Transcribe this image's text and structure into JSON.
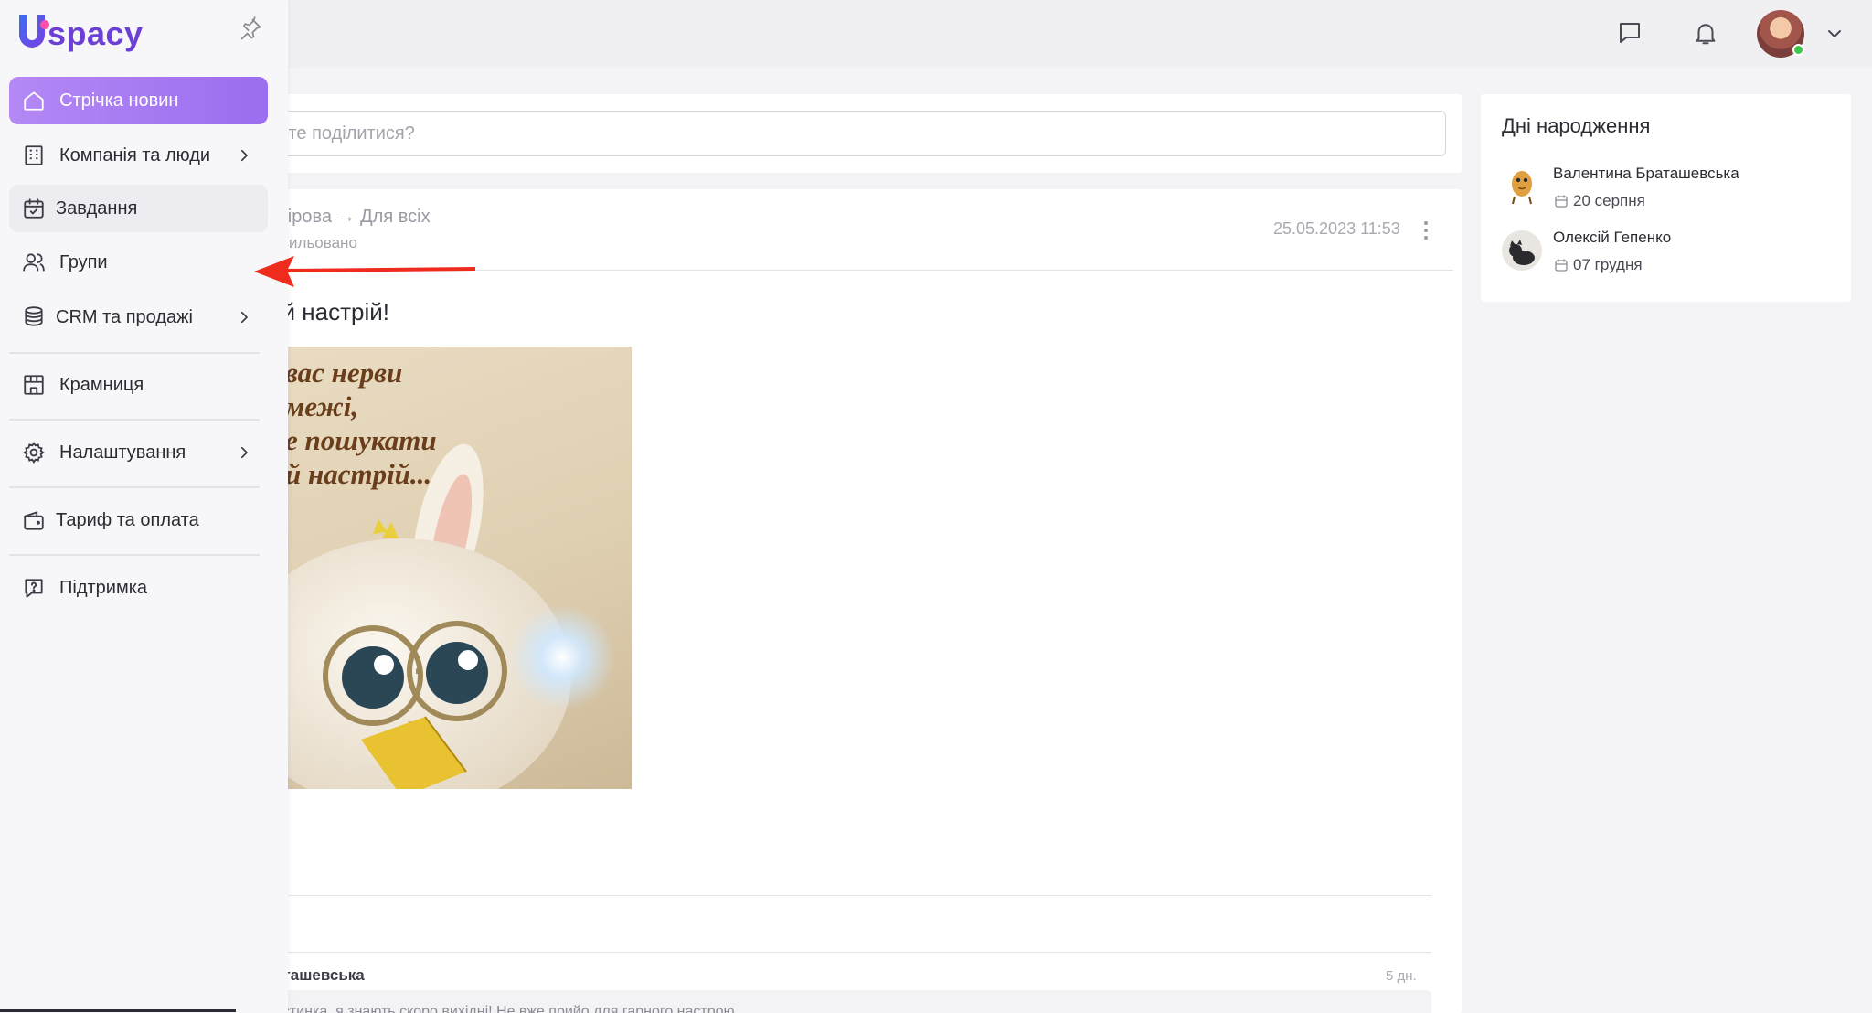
{
  "app": {
    "logo_text": "spacy",
    "brand_color": "#6c3fd6"
  },
  "sidebar": {
    "items": [
      {
        "label": "Стрічка новин",
        "icon": "home-icon",
        "active": true
      },
      {
        "label": "Компанія та люди",
        "icon": "building-icon",
        "has_submenu": true
      },
      {
        "label": "Завдання",
        "icon": "calendar-check-icon"
      },
      {
        "label": "Групи",
        "icon": "users-icon"
      },
      {
        "label": "CRM та продажі",
        "icon": "database-icon",
        "has_submenu": true
      },
      {
        "label": "Крамниця",
        "icon": "store-icon"
      },
      {
        "label": "Налаштування",
        "icon": "gear-icon",
        "has_submenu": true
      },
      {
        "label": "Тариф та оплата",
        "icon": "wallet-icon"
      },
      {
        "label": "Підтримка",
        "icon": "help-icon"
      }
    ]
  },
  "header": {
    "icons": [
      "chat-icon",
      "bell-icon",
      "avatar",
      "chevron-down-icon"
    ],
    "online_color": "#3cc84a"
  },
  "composer": {
    "placeholder": "ете поділитися?"
  },
  "post": {
    "author_line": "шкірова → Для всіх",
    "mood": "схвильовано",
    "date": "25.05.2023 11:53",
    "text": "ий настрій!",
    "image_caption": "вас нерви\nмежі,\nе пошукати\nй настрій..."
  },
  "comment": {
    "author": "аташевська",
    "age": "5 дн.",
    "text": "рстинка, я знають скоро вихідні! Не вже прийо для гарного настрою"
  },
  "birthdays": {
    "title": "Дні народження",
    "people": [
      {
        "name": "Валентина Браташевська",
        "date": "20 серпня"
      },
      {
        "name": "Олексій Гепенко",
        "date": "07 грудня"
      }
    ]
  },
  "accent_color": "#9b6df0"
}
